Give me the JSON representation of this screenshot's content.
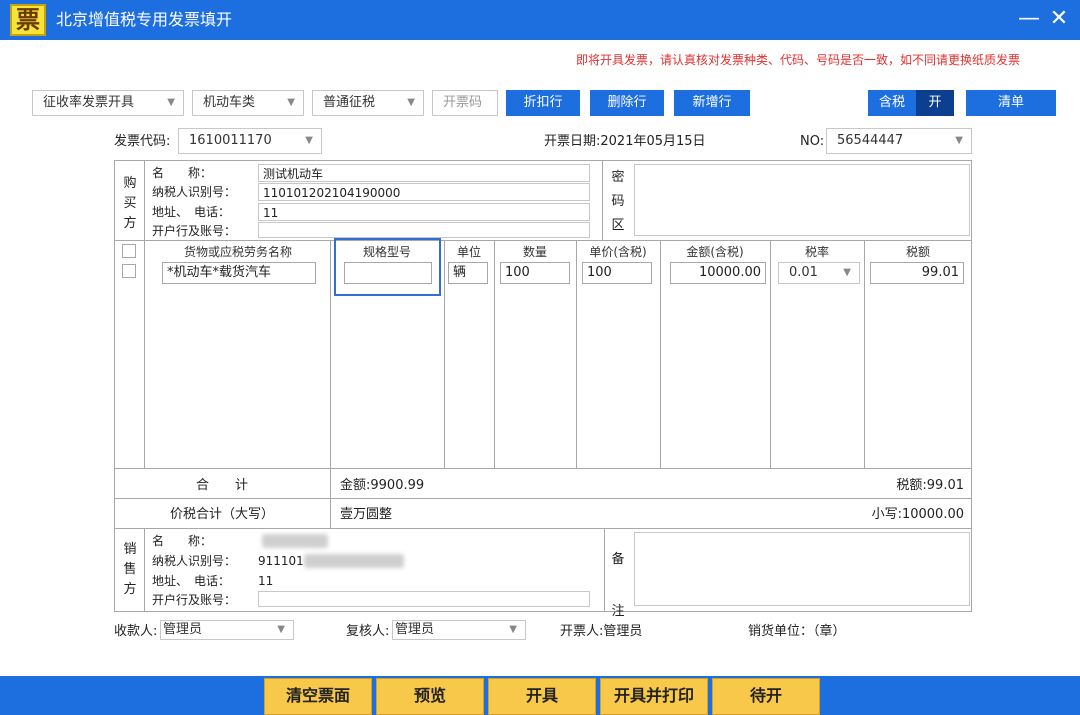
{
  "window": {
    "logo": "票",
    "title": "北京增值税专用发票填开",
    "minimize": "—",
    "close": "✕"
  },
  "notice": "即将开具发票，请认真核对发票种类、代码、号码是否一致，如不同请更换纸质发票",
  "toolbar": {
    "mode_select": "征收率发票开具",
    "vehicle_select": "机动车类",
    "tax_select": "普通征税",
    "invoice_code_placeholder": "开票码",
    "discount_btn": "折扣行",
    "delete_btn": "删除行",
    "add_btn": "新增行",
    "tax_incl_label": "含税",
    "tax_incl_toggle": "开",
    "list_btn": "清单"
  },
  "header": {
    "code_label": "发票代码:",
    "code_value": "1610011170",
    "date_label": "开票日期:2021年05月15日",
    "no_label": "NO:",
    "no_value": "56544447"
  },
  "buyer": {
    "section_label": [
      "购",
      "买",
      "方"
    ],
    "name_label": "名　　称：",
    "name_value": "测试机动车",
    "taxid_label": "纳税人识别号：",
    "taxid_value": "110101202104190000",
    "addr_label": "地址、　电话：",
    "addr_value": "11",
    "bank_label": "开户行及账号：",
    "bank_value": "",
    "secret_label": [
      "密",
      "码",
      "区"
    ]
  },
  "items_header": {
    "name": "货物或应税劳务名称",
    "spec": "规格型号",
    "unit": "单位",
    "qty": "数量",
    "price": "单价(含税)",
    "amount": "金额(含税)",
    "rate": "税率",
    "tax": "税额"
  },
  "item": {
    "name": "*机动车*载货汽车",
    "spec": "",
    "unit": "辆",
    "qty": "100",
    "price": "100",
    "amount": "10000.00",
    "rate": "0.01",
    "tax": "99.01"
  },
  "totals": {
    "sum_label": "合　　计",
    "amount": "金额:9900.99",
    "tax": "税额:99.01",
    "total_label": "价税合计（大写）",
    "total_upper": "壹万圆整",
    "total_lower": "小写:10000.00"
  },
  "seller": {
    "section_label": [
      "销",
      "售",
      "方"
    ],
    "name_label": "名　　称：",
    "taxid_label": "纳税人识别号：",
    "taxid_value": "911101",
    "addr_label": "地址、　电话：",
    "addr_value": "11",
    "bank_label": "开户行及账号：",
    "remark_label": [
      "备",
      "注"
    ]
  },
  "signers": {
    "payee_label": "收款人:",
    "payee_value": "管理员",
    "reviewer_label": "复核人:",
    "reviewer_value": "管理员",
    "issuer_label": "开票人:管理员",
    "seller_stamp": "销货单位：（章）"
  },
  "actions": {
    "clear": "清空票面",
    "preview": "预览",
    "issue": "开具",
    "issue_print": "开具并打印",
    "pending": "待开"
  },
  "colors": {
    "primary": "#1d6fe0",
    "action": "#f7c84a",
    "notice": "#e03030"
  }
}
